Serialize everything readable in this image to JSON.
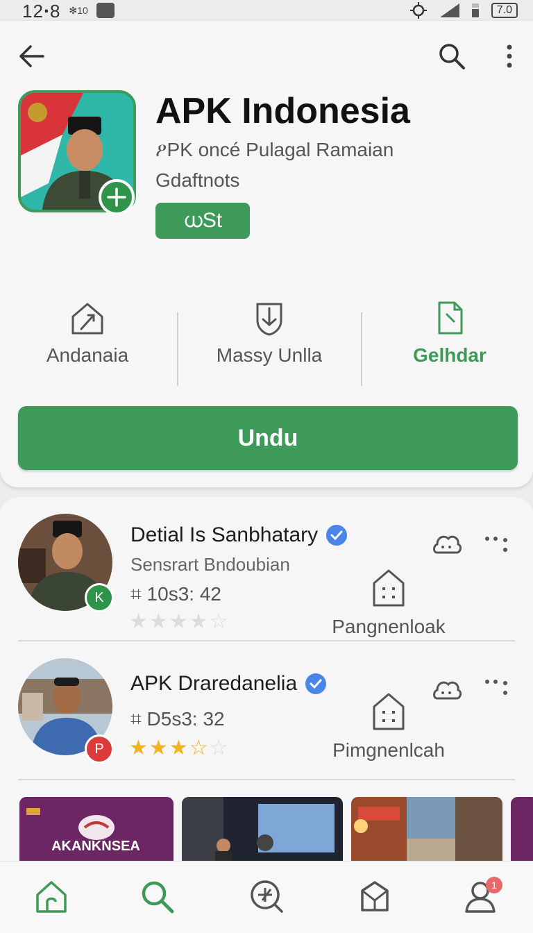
{
  "status_bar": {
    "time": "12ꞏ8",
    "sub": "✻10",
    "battery": "7.0"
  },
  "app": {
    "title": "APK Indonesia",
    "subtitle_line1": "ዖPK oncé Pulagal Ramaian",
    "subtitle_line2": "Gdaftnots",
    "badge": "ധSt",
    "download_label": "Undu"
  },
  "stats": [
    {
      "label": "Andanaia",
      "icon": "share-house-icon"
    },
    {
      "label": "Massy Unlla",
      "icon": "shield-down-icon"
    },
    {
      "label": "Gelhdar",
      "icon": "file-flag-icon"
    }
  ],
  "list": [
    {
      "title": "Detial Is Sanbhatary",
      "subtitle": "Sensrart Bndoubian",
      "meta": "⌗ 10s3: 42",
      "rating": 0,
      "badge": "K",
      "action_label": "Pangnenloak"
    },
    {
      "title": "APK Draredanelia",
      "subtitle": "",
      "meta": "⌗ D5s3: 32",
      "rating": 3.5,
      "badge": "P",
      "action_label": "Pimgnenlcah"
    }
  ],
  "thumbnails": [
    {
      "text": "AKANKNSEA"
    }
  ],
  "nav": {
    "items": [
      "home-icon",
      "search-icon",
      "explore-icon",
      "package-icon",
      "profile-icon"
    ],
    "profile_badge": "1"
  },
  "colors": {
    "accent": "#3d9a58",
    "verified": "#4a86e8",
    "star": "#f0b323"
  }
}
